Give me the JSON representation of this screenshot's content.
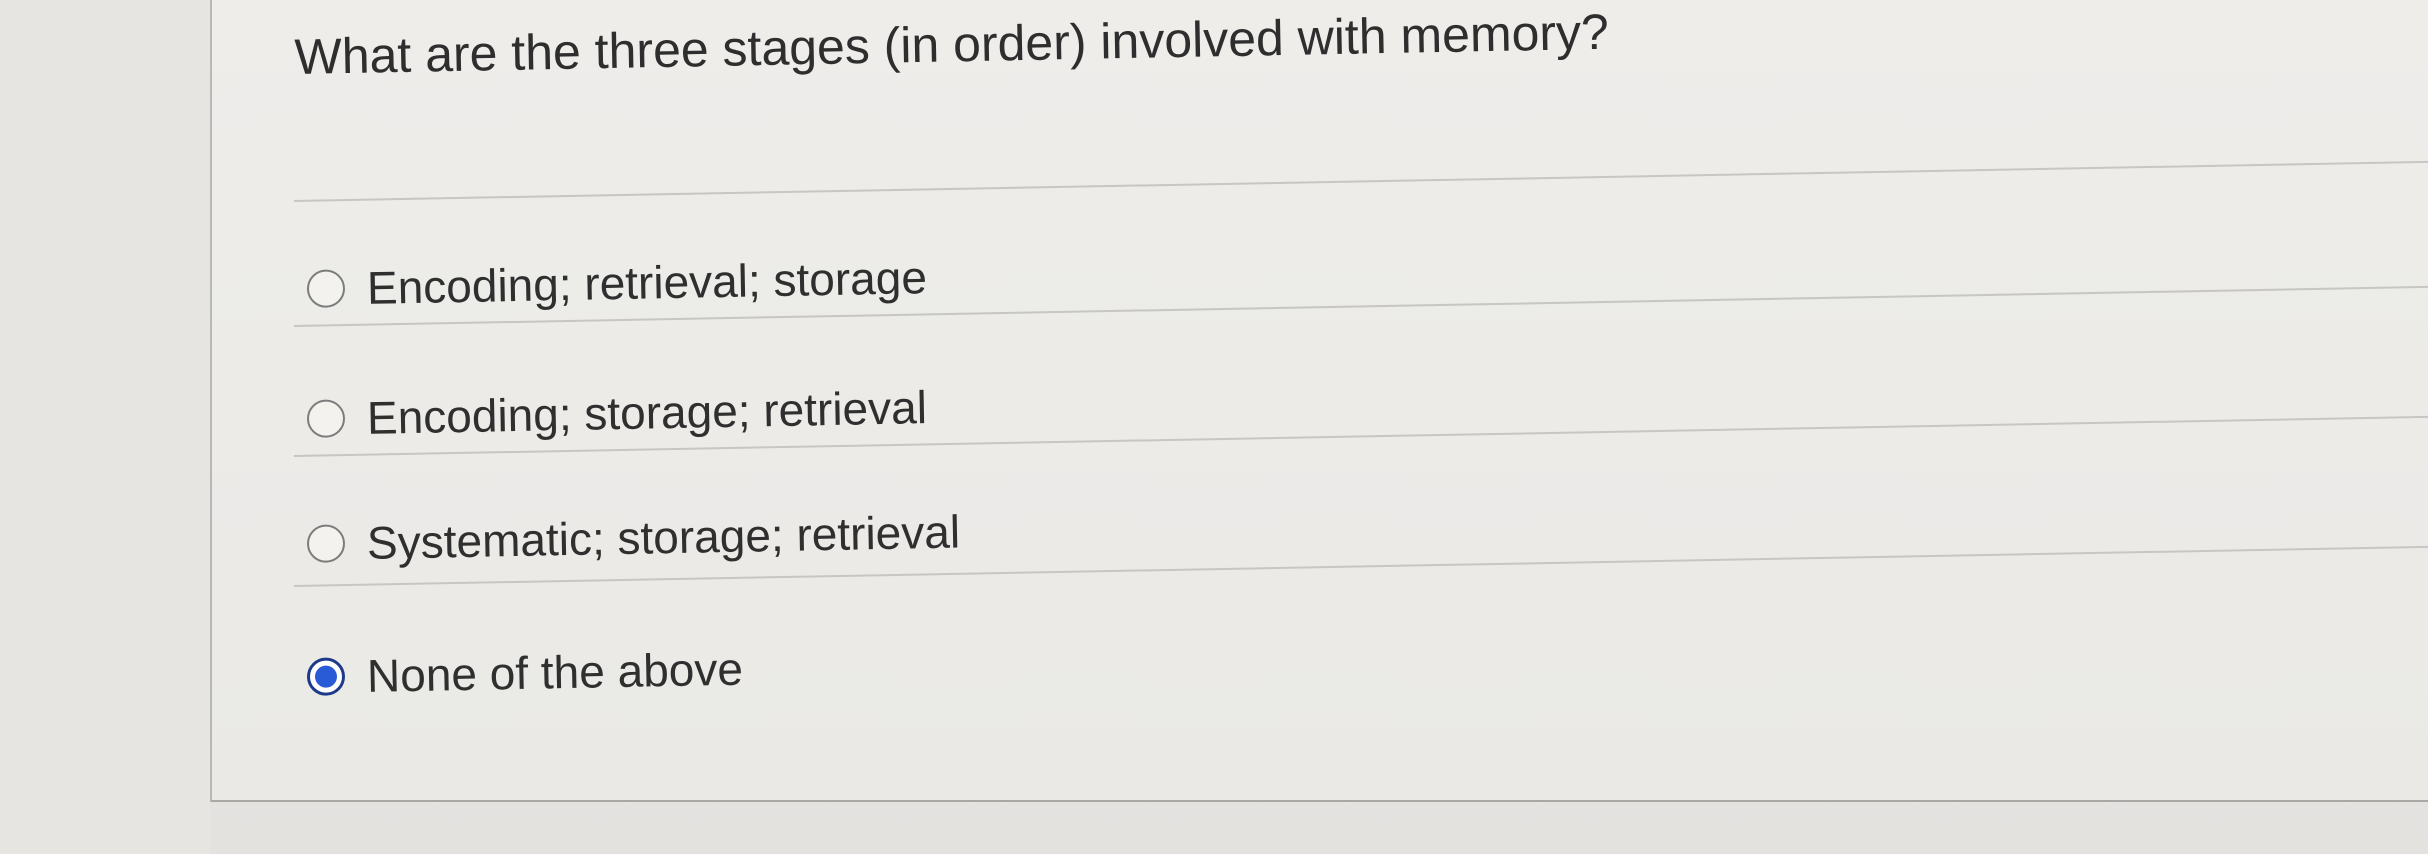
{
  "question": {
    "text": "What are the three stages (in order) involved with memory?"
  },
  "options": [
    {
      "label": "Encoding; retrieval; storage",
      "selected": false
    },
    {
      "label": "Encoding; storage; retrieval",
      "selected": false
    },
    {
      "label": "Systematic; storage; retrieval",
      "selected": false
    },
    {
      "label": "None of the above",
      "selected": true
    }
  ],
  "colors": {
    "selected_radio": "#2a5bd7",
    "text": "#2f2f2f"
  }
}
